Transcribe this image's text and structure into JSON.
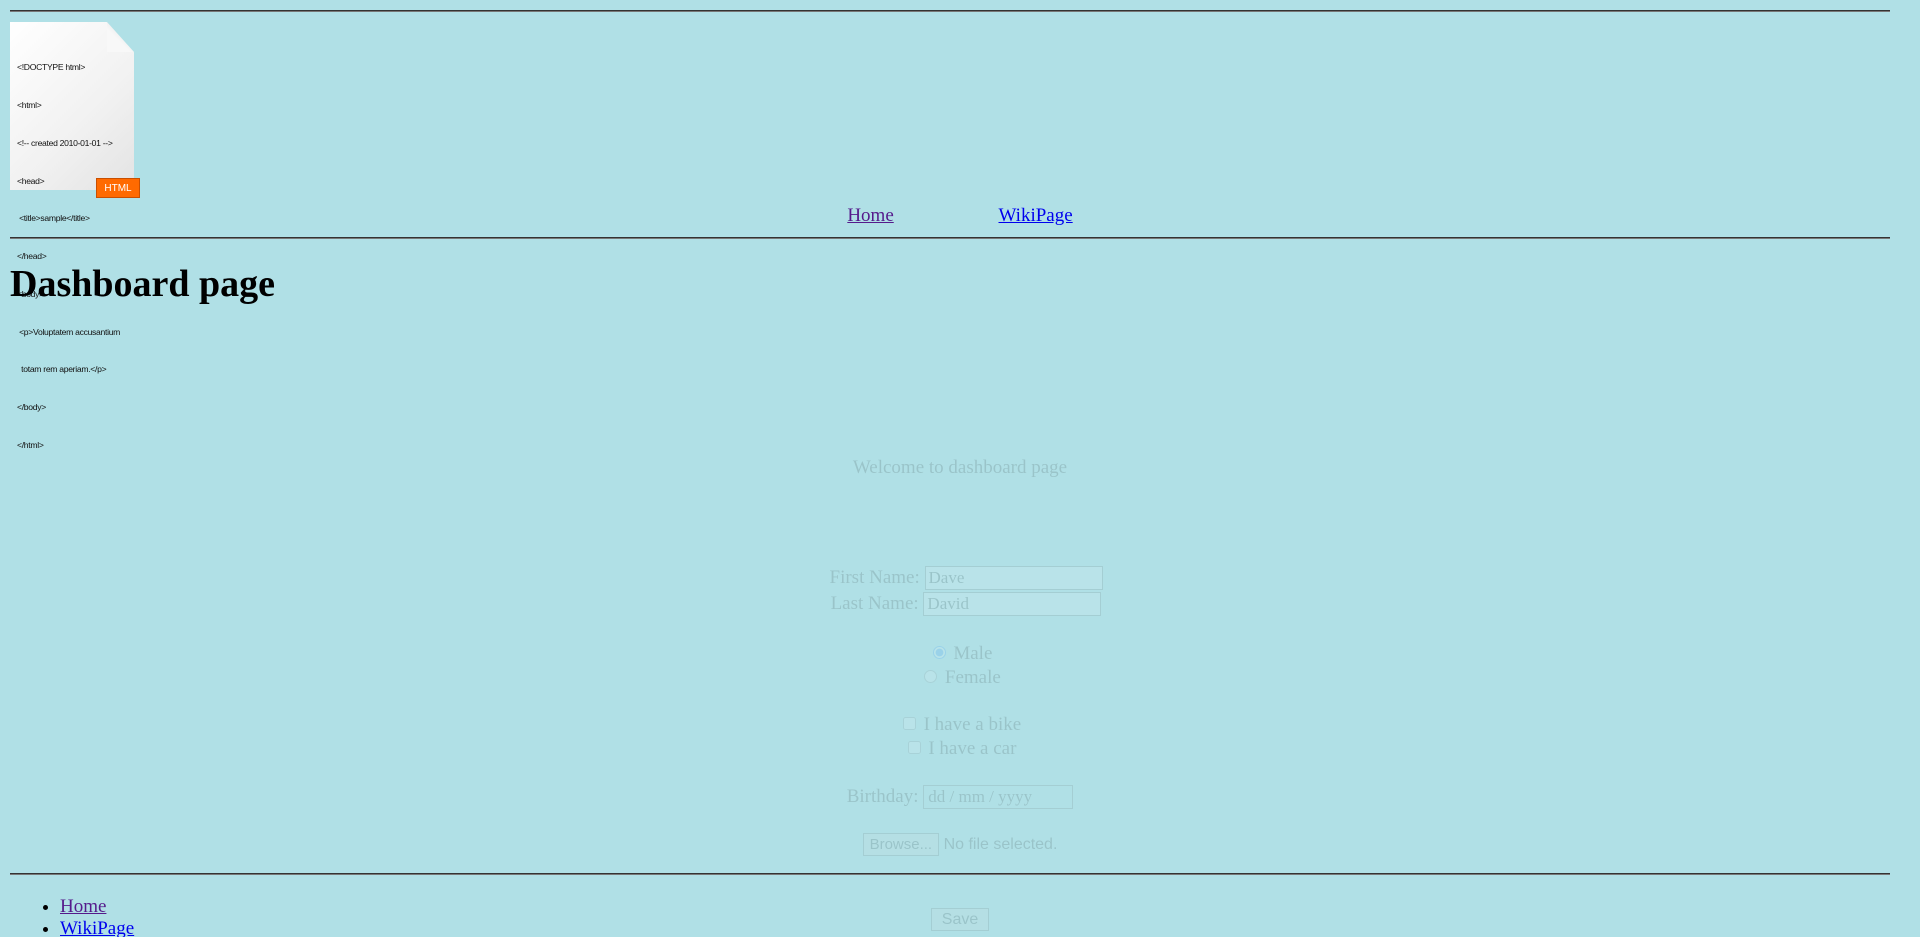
{
  "file_icon": {
    "code_lines": [
      "<!DOCTYPE html>",
      "<html>",
      "<!-- created 2010-01-01 -->",
      "<head>",
      " <title>sample</title>",
      "</head>",
      "<body>",
      " <p>Voluptatem accusantium",
      "  totam rem aperiam.</p>",
      "</body>",
      "</html>"
    ],
    "badge": "HTML"
  },
  "nav": {
    "home": "Home",
    "wiki": "WikiPage"
  },
  "page_title": "Dashboard page",
  "main": {
    "welcome": "Welcome to dashboard page",
    "first_name_label": "First Name:",
    "first_name_value": "Dave",
    "last_name_label": "Last Name:",
    "last_name_value": "David",
    "gender_male": "Male",
    "gender_female": "Female",
    "gender_selected": "Male",
    "bike_label": "I have a bike",
    "car_label": "I have a car",
    "birthday_label": "Birthday:",
    "birthday_placeholder": "dd / mm / yyyy",
    "browse_label": "Browse...",
    "file_status": "No file selected.",
    "save_label": "Save"
  },
  "footer_nav": {
    "home": "Home",
    "wiki": "WikiPage"
  },
  "colors": {
    "background": "#b0e0e6",
    "link": "#0000ee",
    "visited_link": "#551a8b",
    "badge": "#ff6a00"
  }
}
